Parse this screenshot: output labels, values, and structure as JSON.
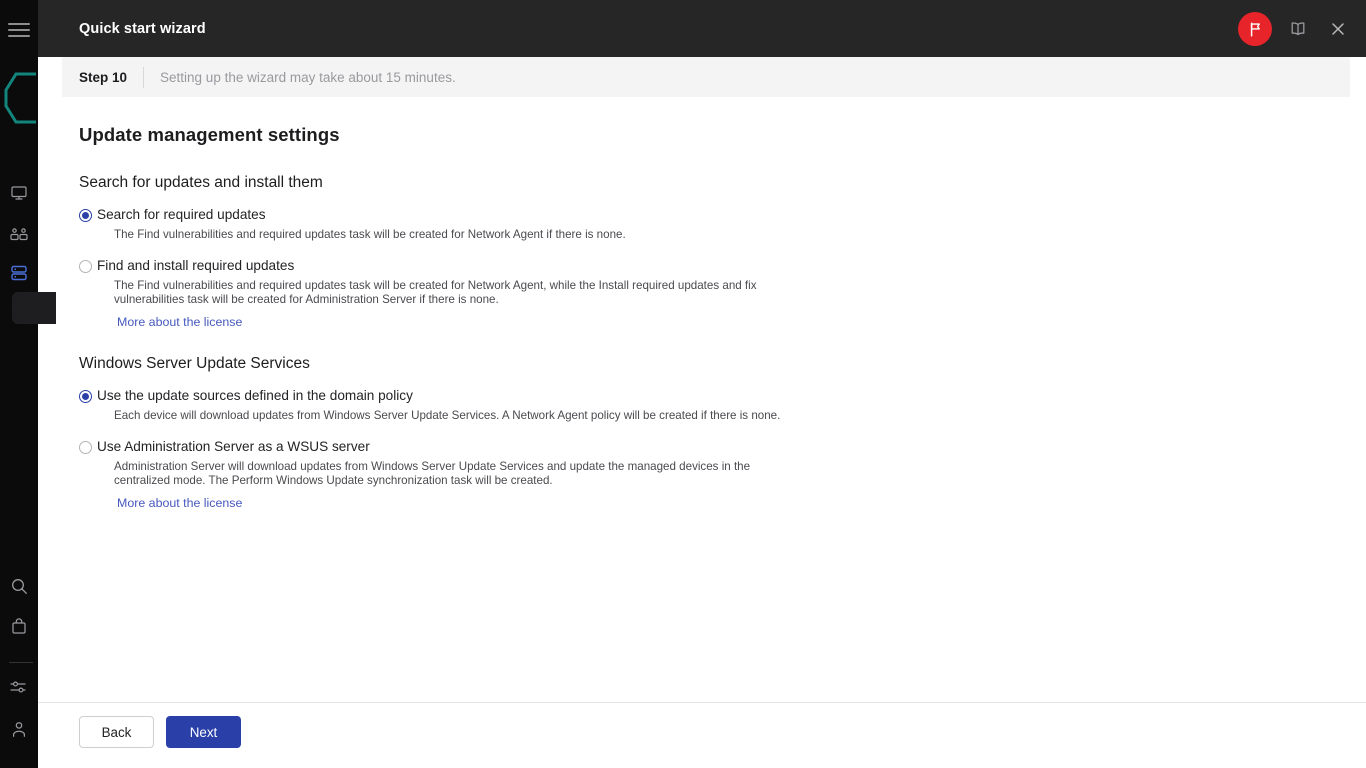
{
  "window": {
    "title": "Quick start wizard",
    "actions": [
      {
        "name": "notifications-flag-badge",
        "icon": "flag-icon"
      },
      {
        "name": "help-book-button",
        "icon": "book-icon"
      },
      {
        "name": "close-button",
        "icon": "close-icon"
      }
    ]
  },
  "sidebar": {
    "menu_icon": "hamburger-menu-icon",
    "logo_icon": "brand-hexagon-logo",
    "items": [
      {
        "name": "sidebar-item-monitoring",
        "icon": "monitor-icon"
      },
      {
        "name": "sidebar-item-users",
        "icon": "users-icon"
      },
      {
        "name": "sidebar-item-devices",
        "icon": "servers-icon",
        "selected": true
      },
      {
        "name": "sidebar-item-search",
        "icon": "search-icon"
      },
      {
        "name": "sidebar-item-marketplace",
        "icon": "bag-icon"
      },
      {
        "name": "sidebar-item-settings",
        "icon": "sliders-icon"
      },
      {
        "name": "sidebar-item-account",
        "icon": "person-icon"
      }
    ]
  },
  "stepbar": {
    "step": "Step 10",
    "note": "Setting up the wizard may take about 15 minutes."
  },
  "page": {
    "title": "Update management settings",
    "sections": [
      {
        "title": "Search for updates and install them",
        "options": [
          {
            "label": "Search for required updates",
            "description": "The Find vulnerabilities and required updates task will be created for Network Agent if there is none.",
            "selected": true,
            "link": null
          },
          {
            "label": "Find and install required updates",
            "description": "The Find vulnerabilities and required updates task will be created for Network Agent, while the Install required updates and fix vulnerabilities task will be created for Administration Server if there is none.",
            "selected": false,
            "link": "More about the license"
          }
        ]
      },
      {
        "title": "Windows Server Update Services",
        "options": [
          {
            "label": "Use the update sources defined in the domain policy",
            "description": "Each device will download updates from Windows Server Update Services. A Network Agent policy will be created if there is none.",
            "selected": true,
            "link": null
          },
          {
            "label": "Use Administration Server as a WSUS server",
            "description": "Administration Server will download updates from Windows Server Update Services and update the managed devices in the centralized mode. The Perform Windows Update synchronization task will be created.",
            "selected": false,
            "link": "More about the license"
          }
        ]
      }
    ]
  },
  "footer": {
    "back_label": "Back",
    "next_label": "Next"
  },
  "colors": {
    "accent": "#2a3fa8",
    "link": "#4759bd",
    "badge_red": "#e8242b",
    "header_dark": "#262626",
    "rail_dark": "#0b0b0c",
    "stepbar_bg": "#f4f4f5",
    "logo_teal": "#12857c"
  }
}
